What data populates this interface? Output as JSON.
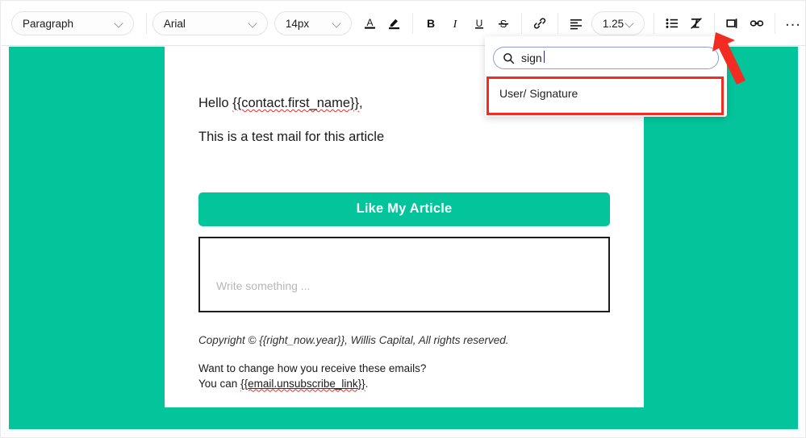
{
  "toolbar": {
    "paragraph_style": "Paragraph",
    "font_family": "Arial",
    "font_size": "14px",
    "line_height": "1.25",
    "buttons": {
      "text_color": "A",
      "highlight_color": "highlight",
      "bold": "B",
      "italic": "I",
      "underline": "U",
      "strikethrough": "S",
      "link": "link",
      "align": "align-left",
      "bullet_list": "bullet-list",
      "clear_formatting": "clear-formatting",
      "merge_tag": "merge-tag",
      "insert_link": "insert-link",
      "more": "..."
    }
  },
  "merge_tag_popover": {
    "search": {
      "value": "sign",
      "placeholder": "Search"
    },
    "results": [
      {
        "label": "User/ Signature"
      }
    ]
  },
  "email": {
    "greeting_prefix": "Hello ",
    "greeting_tag": "{{contact.first_name}}",
    "greeting_suffix": ",",
    "body_line": "This is a test mail for this article",
    "cta_label": "Like My Article",
    "editor_placeholder": "Write something ...",
    "copyright_prefix": "Copyright © ",
    "copyright_tag": "{{right_now.year}}",
    "copyright_suffix": ", Willis Capital, All rights reserved.",
    "footer_question": "Want to change how you receive these emails?",
    "footer_prefix": "You can ",
    "footer_tag": "{{email.unsubscribe_link}}",
    "footer_suffix": "."
  },
  "colors": {
    "brand_teal": "#03c49b",
    "annotation_red": "#f22b23",
    "search_border": "#8b9dd4"
  }
}
